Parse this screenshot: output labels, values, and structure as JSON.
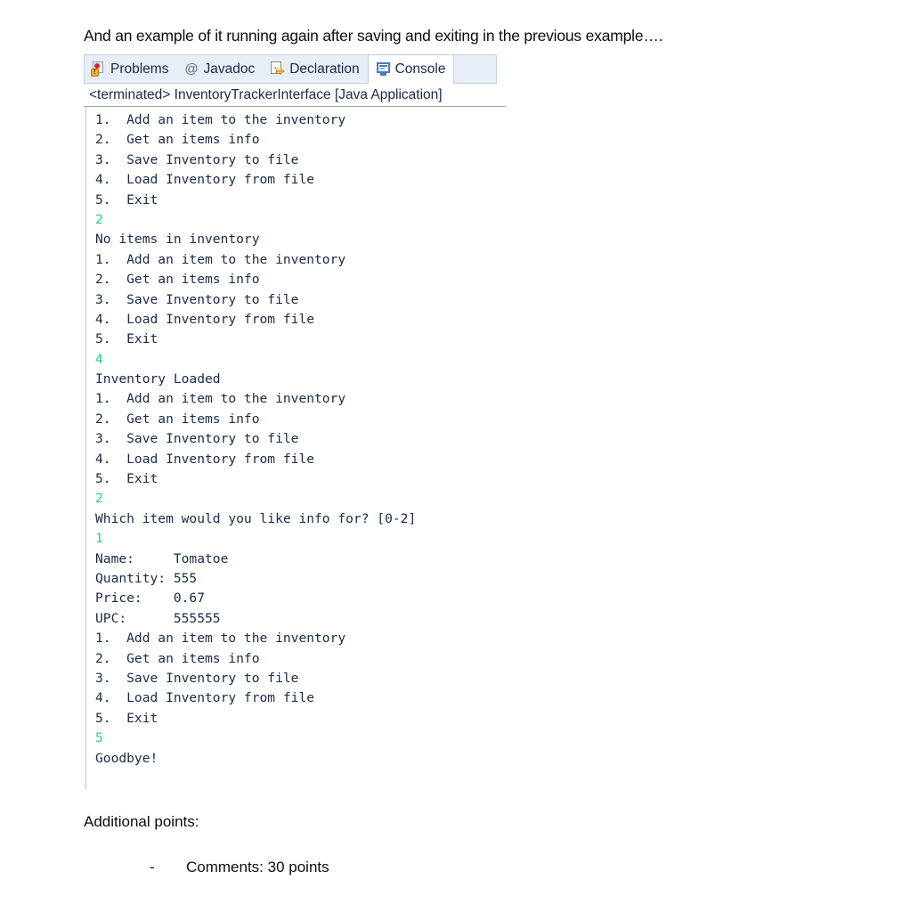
{
  "document": {
    "intro_text": "And an example of it running again after saving and exiting in the previous example….",
    "additional_points_label": "Additional points:",
    "bullet_dash": "-",
    "bullet_text": "Comments: 30 points"
  },
  "view_stack": {
    "tabs": [
      {
        "label": "Problems",
        "icon": "problems-icon",
        "active": false
      },
      {
        "label": "Javadoc",
        "icon": "javadoc-at-icon",
        "active": false
      },
      {
        "label": "Declaration",
        "icon": "declaration-icon",
        "active": false
      },
      {
        "label": "Console",
        "icon": "console-monitor-icon",
        "active": true
      }
    ]
  },
  "console": {
    "launch_header": "<terminated> InventoryTrackerInterface [Java Application]",
    "colors": {
      "output_text": "#1b2a46",
      "input_text": "#27cf87",
      "tab_inactive_bg": "#e8eef7",
      "tab_active_bg": "#ffffff",
      "border": "#c3cede"
    },
    "lines": [
      {
        "text": "1.  Add an item to the inventory",
        "kind": "output"
      },
      {
        "text": "2.  Get an items info",
        "kind": "output"
      },
      {
        "text": "3.  Save Inventory to file",
        "kind": "output"
      },
      {
        "text": "4.  Load Inventory from file",
        "kind": "output"
      },
      {
        "text": "5.  Exit",
        "kind": "output"
      },
      {
        "text": "2",
        "kind": "input"
      },
      {
        "text": "No items in inventory",
        "kind": "output"
      },
      {
        "text": "1.  Add an item to the inventory",
        "kind": "output"
      },
      {
        "text": "2.  Get an items info",
        "kind": "output"
      },
      {
        "text": "3.  Save Inventory to file",
        "kind": "output"
      },
      {
        "text": "4.  Load Inventory from file",
        "kind": "output"
      },
      {
        "text": "5.  Exit",
        "kind": "output"
      },
      {
        "text": "4",
        "kind": "input"
      },
      {
        "text": "Inventory Loaded",
        "kind": "output"
      },
      {
        "text": "1.  Add an item to the inventory",
        "kind": "output"
      },
      {
        "text": "2.  Get an items info",
        "kind": "output"
      },
      {
        "text": "3.  Save Inventory to file",
        "kind": "output"
      },
      {
        "text": "4.  Load Inventory from file",
        "kind": "output"
      },
      {
        "text": "5.  Exit",
        "kind": "output"
      },
      {
        "text": "2",
        "kind": "input"
      },
      {
        "text": "Which item would you like info for? [0-2]",
        "kind": "output"
      },
      {
        "text": "1",
        "kind": "input"
      },
      {
        "text": "Name:     Tomatoe",
        "kind": "output"
      },
      {
        "text": "Quantity: 555",
        "kind": "output"
      },
      {
        "text": "Price:    0.67",
        "kind": "output"
      },
      {
        "text": "UPC:      555555",
        "kind": "output"
      },
      {
        "text": "1.  Add an item to the inventory",
        "kind": "output"
      },
      {
        "text": "2.  Get an items info",
        "kind": "output"
      },
      {
        "text": "3.  Save Inventory to file",
        "kind": "output"
      },
      {
        "text": "4.  Load Inventory from file",
        "kind": "output"
      },
      {
        "text": "5.  Exit",
        "kind": "output"
      },
      {
        "text": "5",
        "kind": "input"
      },
      {
        "text": "Goodbye!",
        "kind": "output"
      }
    ],
    "item_record": {
      "name": "Tomatoe",
      "quantity": "555",
      "price": "0.67",
      "upc": "555555"
    }
  }
}
